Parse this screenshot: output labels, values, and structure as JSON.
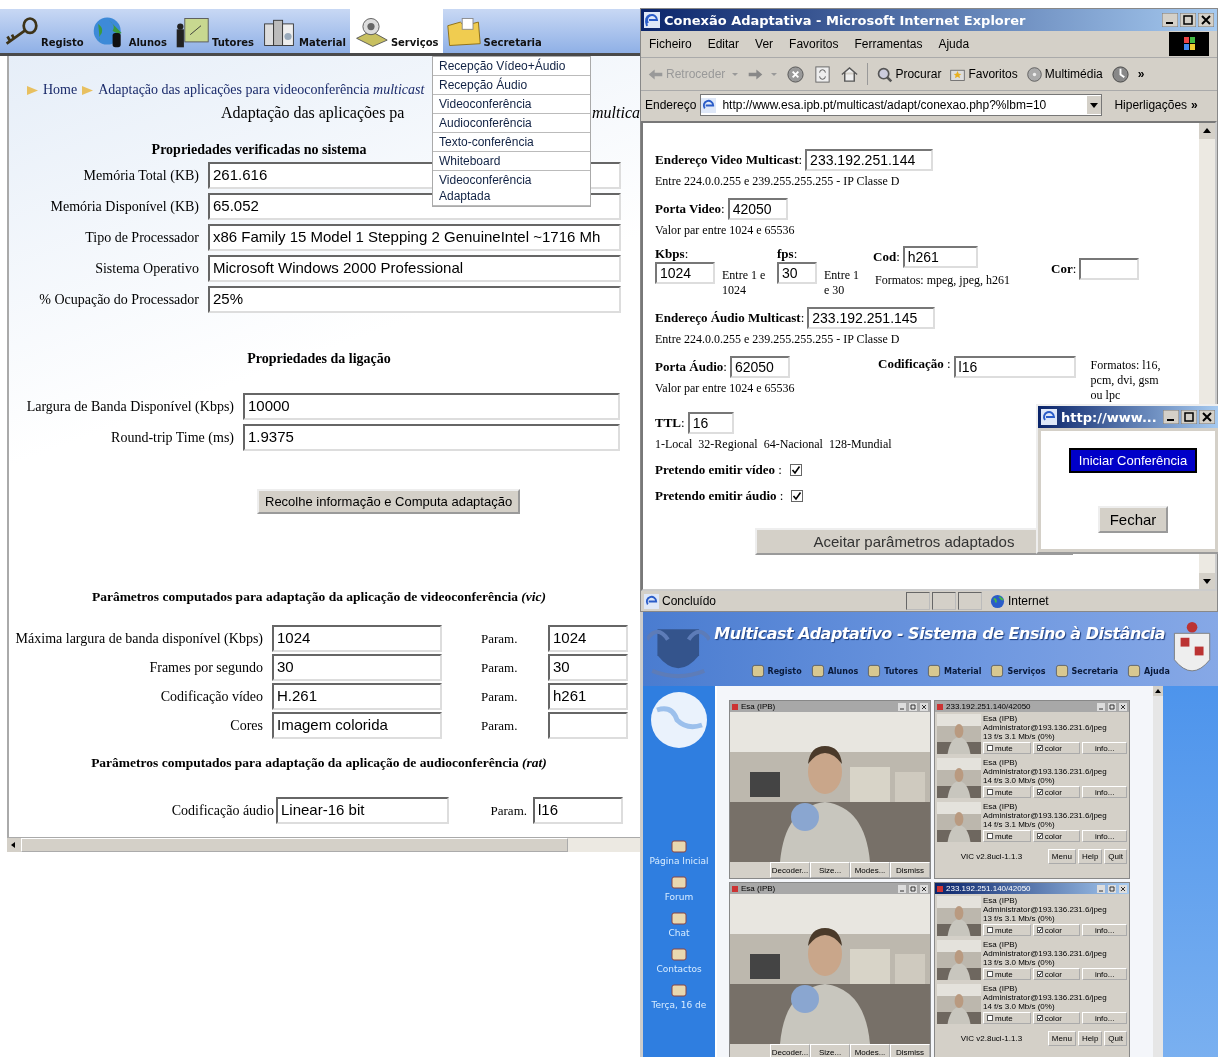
{
  "site": {
    "nav_tabs": [
      {
        "label": "Registo",
        "selected": false
      },
      {
        "label": "Alunos",
        "selected": false
      },
      {
        "label": "Tutores",
        "selected": false
      },
      {
        "label": "Material",
        "selected": false
      },
      {
        "label": "Serviços",
        "selected": true
      },
      {
        "label": "Secretaria",
        "selected": false
      }
    ],
    "services_menu": [
      "Recepção Vídeo+Áudio",
      "Recepção Áudio",
      "Videoconferência",
      "Audioconferência",
      "Texto-conferência",
      "Whiteboard",
      "Videoconferência Adaptada"
    ],
    "breadcrumb": [
      "Home",
      "Adaptação das aplicações para videoconferência *multicast*"
    ],
    "heading": [
      "Adaptação das aplicações pa",
      "multica"
    ],
    "system_section": {
      "title": "Propriedades verificadas no sistema",
      "rows": [
        {
          "label": "Memória Total (KB)",
          "value": "261.616"
        },
        {
          "label": "Memória Disponível (KB)",
          "value": "65.052"
        },
        {
          "label": "Tipo de Processador",
          "value": "x86 Family 15 Model 1 Stepping 2 GenuineIntel ~1716 Mh"
        },
        {
          "label": "Sistema Operativo",
          "value": "Microsoft Windows 2000 Professional"
        },
        {
          "label": "% Ocupação do Processador",
          "value": "25%"
        }
      ]
    },
    "link_section": {
      "title": "Propriedades da ligação",
      "rows": [
        {
          "label": "Largura de Banda Disponível (Kbps)",
          "value": "10000"
        },
        {
          "label": "Round-trip Time (ms)",
          "value": "1.9375"
        }
      ]
    },
    "collect_button": "Recolhe informação e Computa adaptação",
    "vic_section": {
      "title": "Parâmetros computados para adaptação da aplicação de videoconferência *(vic)*",
      "rows": [
        {
          "label": "Máxima largura de banda disponível (Kbps)",
          "value": "1024",
          "param_label": "Param.",
          "param_value": "1024"
        },
        {
          "label": "Frames por segundo",
          "value": "30",
          "param_label": "Param.",
          "param_value": "30"
        },
        {
          "label": "Codificação vídeo",
          "value": "H.261",
          "param_label": "Param.",
          "param_value": "h261"
        },
        {
          "label": "Cores",
          "value": "Imagem colorida",
          "param_label": "Param."
        }
      ]
    },
    "rat_section": {
      "title": "Parâmetros computados para adaptação da aplicação de audioconferência *(rat)*",
      "rows": [
        {
          "label": "Codificação áudio",
          "value": "Linear-16 bit",
          "param_label": "Param.",
          "param_value": "l16"
        }
      ]
    }
  },
  "ie_window": {
    "title": "Conexão Adaptativa - Microsoft Internet Explorer",
    "menu": [
      "Ficheiro",
      "Editar",
      "Ver",
      "Favoritos",
      "Ferramentas",
      "Ajuda"
    ],
    "toolbar": {
      "back": "Retroceder",
      "search": "Procurar",
      "favorites": "Favoritos",
      "media": "Multimédia",
      "more": "»"
    },
    "address": {
      "label": "Endereço",
      "url": "http://www.esa.ipb.pt/multicast/adapt/conexao.php?%lbm=10",
      "links": "Hiperligações",
      "more": "»"
    },
    "form": {
      "video_address": {
        "label": "**Endereço Video Multicast**:",
        "value": "233.192.251.144",
        "hint": "Entre 224.0.0.255 e 239.255.255.255 - IP Classe D"
      },
      "video_port": {
        "label": "**Porta Video**:",
        "value": "42050",
        "hint": "Valor par entre 1024 e 65536"
      },
      "kbps": {
        "label": "**Kbps**:",
        "value": "1024",
        "hint": "Entre 1 e 1024"
      },
      "fps": {
        "label": "**fps**:",
        "value": "30",
        "hint": "Entre 1 e 30"
      },
      "codec": {
        "label": "**Cod**:",
        "value": "h261",
        "hint": "Formatos: mpeg, jpeg, h261"
      },
      "color": {
        "label": "**Cor**:"
      },
      "audio_address": {
        "label": "**Endereço Áudio Multicast**:",
        "value": "233.192.251.145",
        "hint": "Entre 224.0.0.255 e 239.255.255.255 - IP Classe D"
      },
      "audio_port": {
        "label": "**Porta Áudio**:",
        "value": "62050",
        "hint": "Valor par entre 1024 e 65536"
      },
      "audio_codec": {
        "label": "**Codificação** :",
        "value": "l16",
        "hint": "Formatos: l16, pcm, dvi, gsm ou lpc"
      },
      "ttl": {
        "label": "**TTL**:",
        "value": "16",
        "hint": "1-Local  32-Regional  64-Nacional  128-Mundial"
      },
      "checks": [
        {
          "label": "**Pretendo emitir vídeo** :",
          "checked": true
        },
        {
          "label": "**Pretendo emitir áudio** :",
          "checked": true
        }
      ],
      "accept_button": "Aceitar parâmetros adaptados"
    },
    "status": {
      "text": "Concluído",
      "zone": "Internet"
    }
  },
  "popup": {
    "title": "http://www...",
    "start_button": "Iniciar Conferência",
    "close_button": "Fechar"
  },
  "portal": {
    "title": "Multicast Adaptativo - Sistema de Ensino à Distância",
    "nav": [
      "Registo",
      "Alunos",
      "Tutores",
      "Material",
      "Serviços",
      "Secretaria",
      "Ajuda"
    ],
    "sidebar": [
      "Página Inicial",
      "Forum",
      "Chat",
      "Contactos",
      "Terça, 16 de"
    ],
    "vic_windows": [
      {
        "kind": "video",
        "title": "Esa (IPB)",
        "active": false,
        "buttons": [
          "Decoder...",
          "Size...",
          "Modes...",
          "Dismiss"
        ]
      },
      {
        "kind": "list",
        "title": "233.192.251.140/42050",
        "active": false,
        "version": "VIC v2.8ucl-1.1.3",
        "buttons": [
          "Menu",
          "Help",
          "Quit"
        ],
        "sources": [
          {
            "name": "Esa (IPB)",
            "address": "Administrator@193.136.231.6/jpeg",
            "stats": "13 f/s  3.1 Mb/s  (0%)",
            "mute_label": "mute",
            "mute": false,
            "color_label": "color",
            "color": true,
            "info_button": "info..."
          },
          {
            "name": "Esa (IPB)",
            "address": "Administrator@193.136.231.6/jpeg",
            "stats": "14 f/s  3.0 Mb/s  (0%)",
            "mute_label": "mute",
            "mute": false,
            "color_label": "color",
            "color": true,
            "info_button": "info..."
          },
          {
            "name": "Esa (IPB)",
            "address": "Administrator@193.136.231.6/jpeg",
            "stats": "14 f/s  3.1 Mb/s  (0%)",
            "mute_label": "mute",
            "mute": false,
            "color_label": "color",
            "color": true,
            "info_button": "info..."
          }
        ]
      },
      {
        "kind": "video",
        "title": "Esa (IPB)",
        "active": false,
        "buttons": [
          "Decoder...",
          "Size...",
          "Modes...",
          "Dismiss"
        ]
      },
      {
        "kind": "list",
        "title": "233.192.251.140/42050",
        "active": true,
        "version": "VIC v2.8ucl-1.1.3",
        "buttons": [
          "Menu",
          "Help",
          "Quit"
        ],
        "sources": [
          {
            "name": "Esa (IPB)",
            "address": "Administrator@193.136.231.6/jpeg",
            "stats": "13 f/s  3.1 Mb/s  (0%)",
            "mute_label": "mute",
            "mute": false,
            "color_label": "color",
            "color": true,
            "info_button": "info..."
          },
          {
            "name": "Esa (IPB)",
            "address": "Administrator@193.136.231.6/jpeg",
            "stats": "13 f/s  3.0 Mb/s  (0%)",
            "mute_label": "mute",
            "mute": false,
            "color_label": "color",
            "color": true,
            "info_button": "info..."
          },
          {
            "name": "Esa (IPB)",
            "address": "Administrator@193.136.231.6/jpeg",
            "stats": "14 f/s  3.0 Mb/s  (0%)",
            "mute_label": "mute",
            "mute": false,
            "color_label": "color",
            "color": true,
            "info_button": "info..."
          }
        ]
      }
    ]
  }
}
